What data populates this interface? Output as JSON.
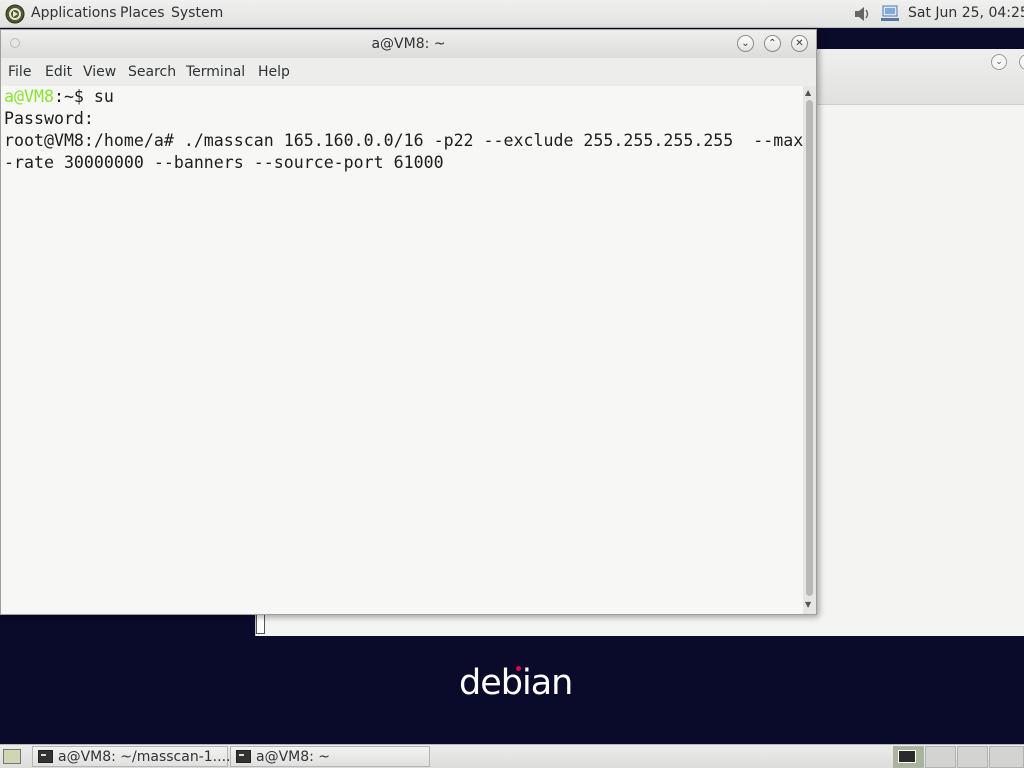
{
  "top_panel": {
    "menus": [
      "Applications",
      "Places",
      "System"
    ],
    "clock": "Sat Jun 25, 04:25",
    "icons": [
      "debian-swirl-icon",
      "sound-icon",
      "network-icon"
    ]
  },
  "terminal": {
    "title": "a@VM8: ~",
    "menu": [
      "File",
      "Edit",
      "View",
      "Search",
      "Terminal",
      "Help"
    ],
    "lines": {
      "l1_user": "a@VM8",
      "l1_rest": ":~$ su",
      "l2": "Password:",
      "l3": "root@VM8:/home/a# ./masscan 165.160.0.0/16 -p22 --exclude 255.255.255.255  --max",
      "l4": "-rate 30000000 --banners --source-port 61000"
    },
    "colors": {
      "prompt_user": "#8ae234"
    }
  },
  "desktop": {
    "logo_text": "debian"
  },
  "taskbar": {
    "tasks": [
      "a@VM8: ~/masscan-1....",
      "a@VM8: ~"
    ]
  }
}
